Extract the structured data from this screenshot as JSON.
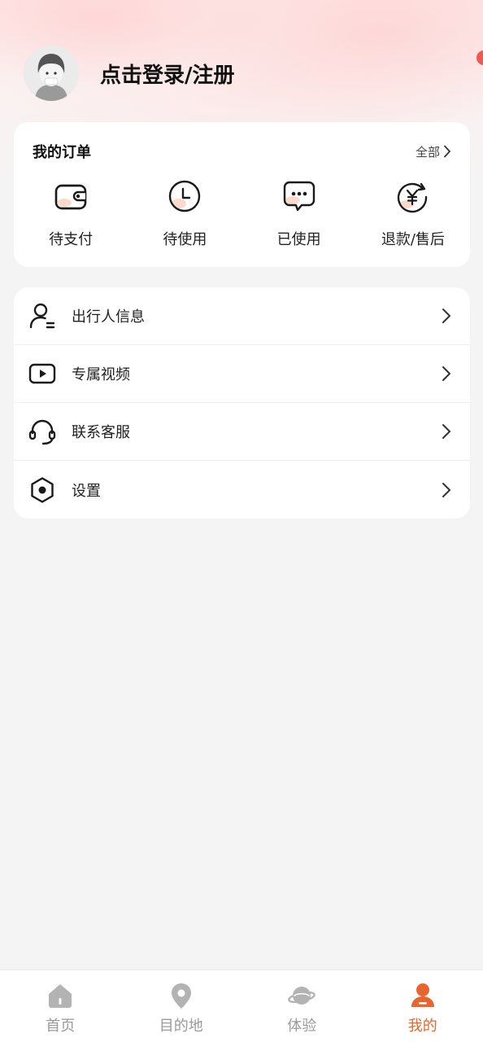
{
  "header": {
    "login_text": "点击登录/注册"
  },
  "orders": {
    "title": "我的订单",
    "all_label": "全部",
    "items": [
      {
        "label": "待支付",
        "icon": "wallet-icon"
      },
      {
        "label": "待使用",
        "icon": "clock-icon"
      },
      {
        "label": "已使用",
        "icon": "chat-bubble-icon"
      },
      {
        "label": "退款/售后",
        "icon": "refund-yuan-icon"
      }
    ]
  },
  "menu": {
    "items": [
      {
        "label": "出行人信息",
        "icon": "traveler-icon"
      },
      {
        "label": "专属视频",
        "icon": "video-play-icon"
      },
      {
        "label": "联系客服",
        "icon": "headset-icon"
      },
      {
        "label": "设置",
        "icon": "settings-hexagon-icon"
      }
    ]
  },
  "tabbar": {
    "items": [
      {
        "label": "首页",
        "icon": "home-icon",
        "active": false
      },
      {
        "label": "目的地",
        "icon": "location-pin-icon",
        "active": false
      },
      {
        "label": "体验",
        "icon": "planet-icon",
        "active": false
      },
      {
        "label": "我的",
        "icon": "profile-icon",
        "active": true
      }
    ]
  },
  "colors": {
    "accent": "#e8662e",
    "tab_inactive": "#9a9a9a",
    "icon_highlight": "#fbd9cc"
  }
}
